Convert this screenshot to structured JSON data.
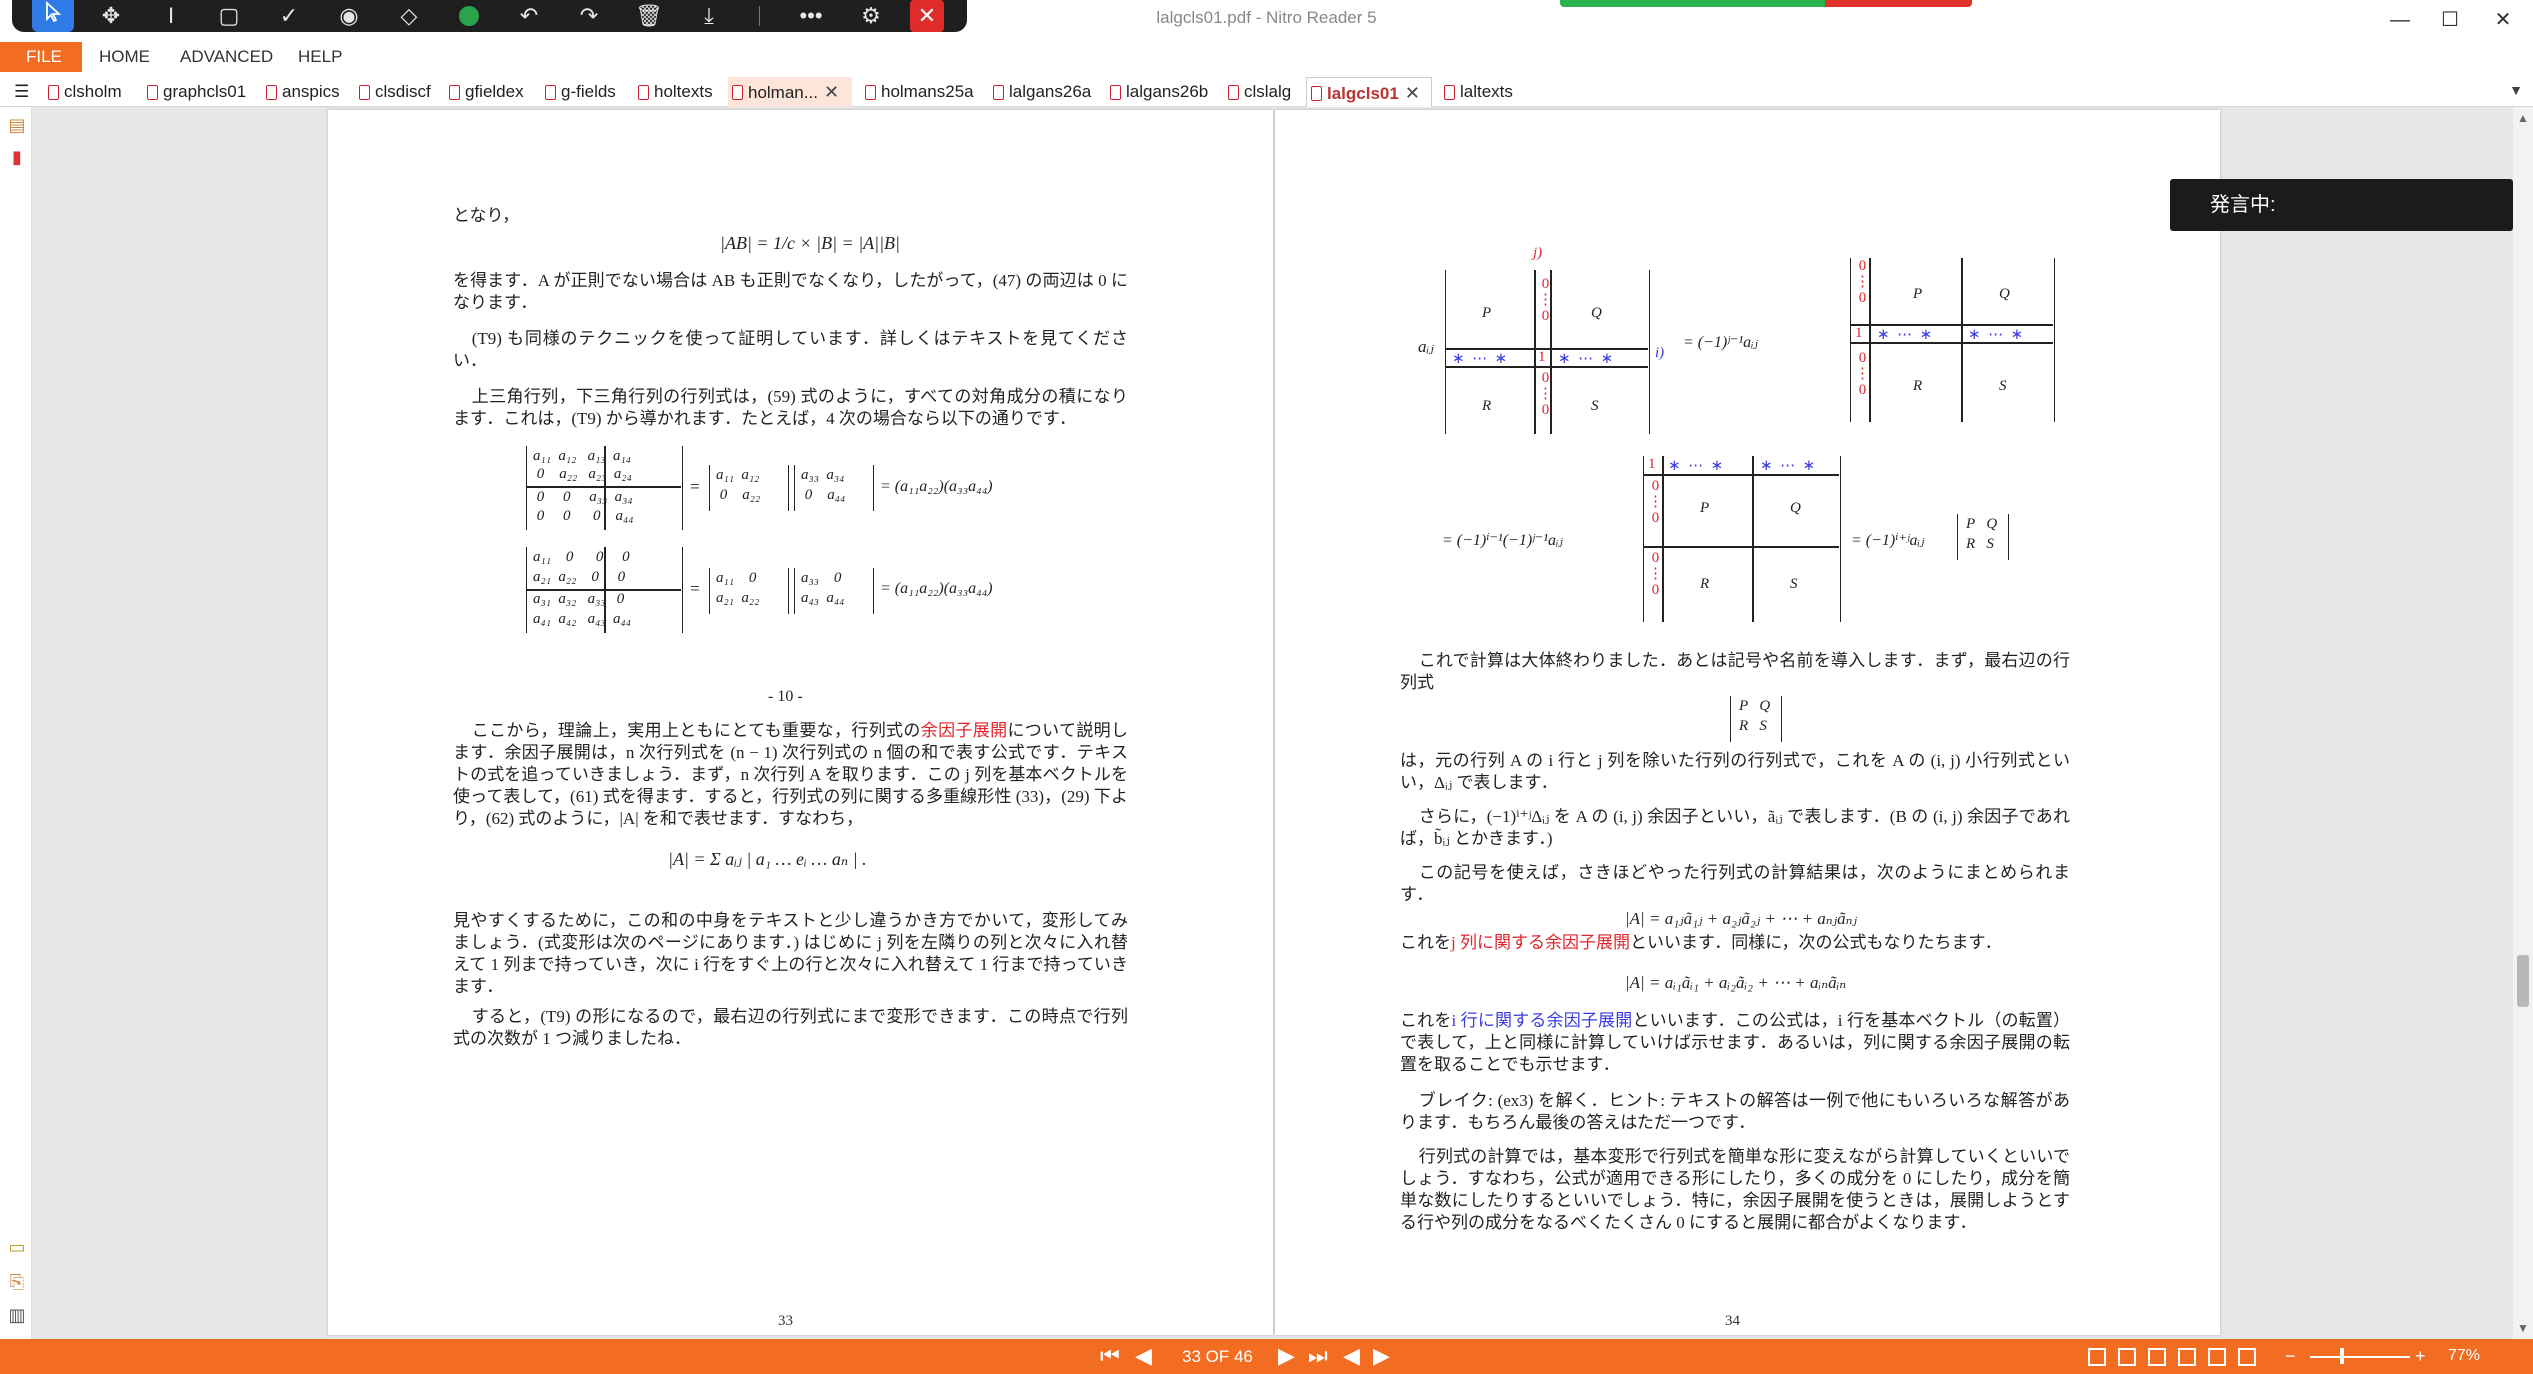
{
  "window": {
    "title": "lalgcls01.pdf - Nitro Reader 5",
    "minimize": "—",
    "maximize": "☐",
    "close": "✕"
  },
  "toolbar": {
    "icons": [
      "select-icon",
      "move-icon",
      "text-cursor-icon",
      "rectangle-icon",
      "check-icon",
      "stamp-icon",
      "eraser-icon",
      "color-dot-icon",
      "undo-icon",
      "redo-icon",
      "delete-icon",
      "download-icon",
      "more-icon",
      "user-settings-icon",
      "close-icon"
    ],
    "accent": "#2f7ae5",
    "close_color": "#e02b2b"
  },
  "menu": {
    "file": "FILE",
    "items": [
      "HOME",
      "ADVANCED",
      "HELP"
    ],
    "accent": "#f26c22"
  },
  "tabs": [
    {
      "label": "clsholm"
    },
    {
      "label": "graphcls01"
    },
    {
      "label": "anspics"
    },
    {
      "label": "clsdiscf"
    },
    {
      "label": "gfieldex"
    },
    {
      "label": "g-fields"
    },
    {
      "label": "holtexts"
    },
    {
      "label": "holman...",
      "close": "✕"
    },
    {
      "label": "holmans25a"
    },
    {
      "label": "lalgans26a"
    },
    {
      "label": "lalgans26b"
    },
    {
      "label": "clslalg"
    },
    {
      "label": "lalgcls01",
      "close": "✕"
    },
    {
      "label": "laltexts"
    }
  ],
  "overlay": {
    "speaking": "発言中:"
  },
  "left_page": {
    "p1": "となり，",
    "eq1": "|AB| = 1/c × |B| = |A||B|",
    "p2": "を得ます．A が正則でない場合は AB も正則でなくなり，したがって，(47) の両辺は 0 になります．",
    "p3": "(T9) も同様のテクニックを使って証明しています．詳しくはテキストを見てください．",
    "p4": "上三角行列，下三角行列の行列式は，(59) 式のように，すべての対角成分の積になります．これは，(T9) から導かれます．たとえば，4 次の場合なら以下の通りです．",
    "eq_upper_rhs": "= (a₁₁a₂₂)(a₃₃a₄₄)",
    "eq_lower_rhs": "= (a₁₁a₂₂)(a₃₃a₄₄)",
    "center_label": "- 10 -",
    "p5_a": "ここから，理論上，実用上ともにとても重要な，行列式の",
    "p5_link": "余因子展開",
    "p5_b": "について説明します．余因子展開は，n 次行列式を (n − 1) 次行列式の n 個の和で表す公式です．テキストの式を追っていきましょう．まず，n 次行列 A を取ります．この j 列を基本ベクトルを使って表して，(61) 式を得ます．すると，行列式の列に関する多重線形性 (33)，(29) 下より，(62) 式のように，|A| を和で表せます．すなわち，",
    "eq_sum": "|A| = Σ aᵢⱼ | a₁ … eᵢ … aₙ | .",
    "p6": "見やすくするために，この和の中身をテキストと少し違うかき方でかいて，変形してみましょう．(式変形は次のページにあります．) はじめに j 列を左隣りの列と次々に入れ替えて 1 列まで持っていき，次に i 行をすぐ上の行と次々に入れ替えて 1 行まで持っていきます．",
    "p7": "すると，(T9) の形になるので，最右辺の行列式にまで変形できます．この時点で行列式の次数が 1 つ減りましたね．",
    "page_number": "33"
  },
  "right_page": {
    "eq_top_rhs": "= (−1)ʲ⁻¹aᵢⱼ",
    "eq_mid_lhs": "= (−1)ⁱ⁻¹(−1)ʲ⁻¹aᵢⱼ",
    "eq_mid_rhs": "= (−1)ⁱ⁺ʲaᵢⱼ",
    "p1": "これで計算は大体終わりました．あとは記号や名前を導入します．まず，最右辺の行列式",
    "p2": "は，元の行列 A の i 行と j 列を除いた行列の行列式で，これを A の (i, j) 小行列式といい，Δᵢⱼ で表します．",
    "p3": "さらに，(−1)ⁱ⁺ʲΔᵢⱼ を A の (i, j) 余因子といい，ãᵢⱼ で表します．(B の (i, j) 余因子であれば，b̃ᵢⱼ とかきます．)",
    "p4": "この記号を使えば，さきほどやった行列式の計算結果は，次のようにまとめられます．",
    "eq_col": "|A| = a₁ⱼã₁ⱼ + a₂ⱼã₂ⱼ + ⋯ + aₙⱼãₙⱼ",
    "p5_a": "これを",
    "p5_link": "j 列に関する余因子展開",
    "p5_b": "といいます．同様に，次の公式もなりたちます．",
    "eq_row": "|A| = aᵢ₁ãᵢ₁ + aᵢ₂ãᵢ₂ + ⋯ + aᵢₙãᵢₙ",
    "p6_a": "これを",
    "p6_link": "i 行に関する余因子展開",
    "p6_b": "といいます．この公式は，i 行を基本ベクトル（の転置）で表して，上と同様に計算していけば示せます．あるいは，列に関する余因子展開の転置を取ることでも示せます．",
    "p7": "ブレイク: (ex3) を解く．ヒント: テキストの解答は一例で他にもいろいろな解答があります．もちろん最後の答えはただ一つです．",
    "p8": "行列式の計算では，基本変形で行列式を簡単な形に変えながら計算していくといいでしょう．すなわち，公式が適用できる形にしたり，多くの成分を 0 にしたり，成分を簡単な数にしたりするといいでしょう．特に，余因子展開を使うときは，展開しようとする行や列の成分をなるべくたくさん 0 にすると展開に都合がよくなります．",
    "page_number": "34"
  },
  "status": {
    "page_indicator": "33 OF 46",
    "zoom": "77%",
    "zoom_minus": "−",
    "zoom_plus": "+",
    "bar_color": "#f26c22"
  }
}
